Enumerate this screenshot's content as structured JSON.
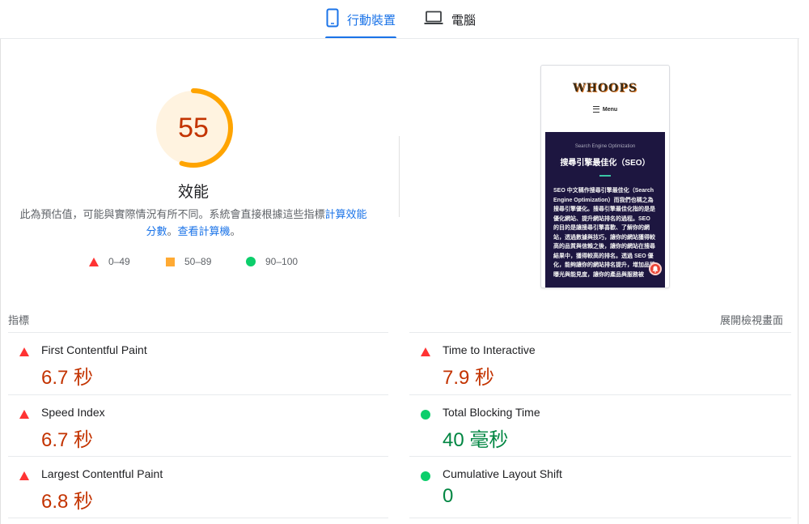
{
  "tabs": {
    "mobile": "行動裝置",
    "desktop": "電腦"
  },
  "performance": {
    "score": "55",
    "score_fraction": 0.55,
    "title": "效能",
    "desc_prefix": "此為預估值，可能與實際情況有所不同。系統會直接根據這些指標",
    "desc_link1": "計算效能分數",
    "desc_separator": "。",
    "desc_link2": "查看計算機",
    "desc_suffix": "。"
  },
  "legend": {
    "fail": "0–49",
    "average": "50–89",
    "pass": "90–100"
  },
  "screenshot": {
    "logo": "WHOOPS",
    "menu": "Menu",
    "kicker": "Search Engine Optimization",
    "heading": "搜尋引擎最佳化（SEO）",
    "body": "SEO 中文稱作搜尋引擎最佳化（Search Engine Optimization）而我們也稱之為搜尋引擎優化。搜尋引擎最佳化指的是是優化網站、提升網站排名的過程。SEO 的目的是讓搜尋引擎喜歡、了解你的網站，透過數據與技巧，讓你的網站獲得較高的品質與信賴之後，讓你的網站在搜尋結果中，獲得較高的排名。透過 SEO 優化，能夠讓你的網站排名提升，增加品牌曝光與能見度，讓你的產品與服務被"
  },
  "metrics": {
    "section_label": "指標",
    "expand_label": "展開檢視畫面",
    "items": [
      {
        "name": "First Contentful Paint",
        "value": "6.7 秒",
        "status": "fail"
      },
      {
        "name": "Time to Interactive",
        "value": "7.9 秒",
        "status": "fail"
      },
      {
        "name": "Speed Index",
        "value": "6.7 秒",
        "status": "fail"
      },
      {
        "name": "Total Blocking Time",
        "value": "40 毫秒",
        "status": "pass"
      },
      {
        "name": "Largest Contentful Paint",
        "value": "6.8 秒",
        "status": "fail"
      },
      {
        "name": "Cumulative Layout Shift",
        "value": "0",
        "status": "pass"
      }
    ]
  },
  "colors": {
    "accent": "#1a73e8",
    "fail": "#ff3333",
    "fail_text": "#c33300",
    "average": "#ffaa33",
    "pass": "#0cce6b",
    "pass_text": "#018642",
    "gauge_track": "#fff3e0",
    "gauge_arc": "#ffa400"
  }
}
